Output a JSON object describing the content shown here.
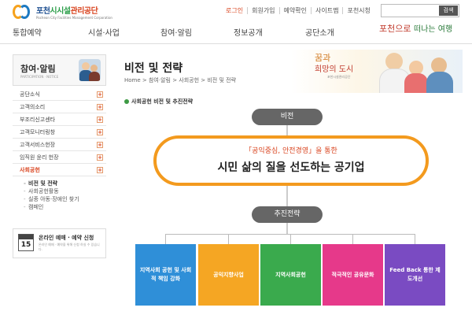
{
  "brand": {
    "name_part1": "포천",
    "name_part2": "시시설",
    "name_part3": "관리공단",
    "sub": "Pocheon City Facilities Management Corporation"
  },
  "util_links": [
    "로그인",
    "회원가입",
    "예약확인",
    "사이트맵",
    "포천시청"
  ],
  "search": {
    "button_label": "검색",
    "placeholder": ""
  },
  "nav": [
    "통합예약",
    "시설·사업",
    "참여·알림",
    "정보공개",
    "공단소개"
  ],
  "slogan": {
    "line1": "포천으로",
    "line2": "떠나는 여행"
  },
  "sidebar": {
    "title": "참여·알림",
    "subtitle": "PARTICIPATION · NOTICE",
    "items": [
      {
        "label": "공단소식"
      },
      {
        "label": "고객의소리"
      },
      {
        "label": "부조리신고센타"
      },
      {
        "label": "고객모니터링창"
      },
      {
        "label": "고객서비스헌장"
      },
      {
        "label": "임직원 윤리 헌장"
      },
      {
        "label": "사회공헌"
      }
    ],
    "sub_items": [
      "비전 및 전략",
      "사회공헌활동",
      "실종 아동·장애인 찾기",
      "캠페인"
    ]
  },
  "online": {
    "calendar_day": "15",
    "title": "온라인 예매 · 예약 신청",
    "desc": "온라인 예매 · 예약을 위해 신청 하실 수 있습니다."
  },
  "main": {
    "title": "비전 및 전략",
    "breadcrumb": "Home > 참여·알림 > 사회공헌 > 비전 및 전략",
    "section_heading": "사회공헌 비전 및 추진전략",
    "vision_label": "비전",
    "vision_sub": "「공익중심, 안전경영」을 통한",
    "vision_main": "시민 삶의 질을 선도하는 공기업",
    "strategy_label": "추진전략",
    "strategies": [
      {
        "label": "지역사회 공헌 및 사회적 책임 강화",
        "color": "#2f8fd8"
      },
      {
        "label": "공익지향사업",
        "color": "#f5a623"
      },
      {
        "label": "지역사회공헌",
        "color": "#3aaa4d"
      },
      {
        "label": "적극적인 공유문화",
        "color": "#e6398a"
      },
      {
        "label": "Feed Back 통한 제도개선",
        "color": "#7a4bc2"
      }
    ]
  },
  "banner": {
    "line1": "꿈과",
    "line2": "희망의 도시",
    "line3": "포천시설관리공단"
  }
}
